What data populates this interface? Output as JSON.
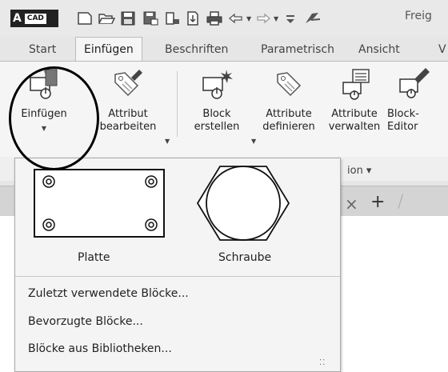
{
  "app": {
    "badge": "A",
    "badge_sub": "CAD",
    "title_partial": "Freig"
  },
  "qat": {
    "icons": [
      "new-file-icon",
      "open-folder-icon",
      "save-icon",
      "save-as-icon",
      "cloud-open-icon",
      "cloud-save-icon",
      "print-icon",
      "undo-icon",
      "redo-icon",
      "customize-dropdown-icon",
      "share-icon"
    ]
  },
  "tabs": [
    {
      "label": "Start",
      "active": false
    },
    {
      "label": "Einfügen",
      "active": true
    },
    {
      "label": "Beschriften",
      "active": false
    },
    {
      "label": "Parametrisch",
      "active": false
    },
    {
      "label": "Ansicht",
      "active": false
    },
    {
      "label": "V",
      "active": false
    }
  ],
  "ribbon": {
    "insert": {
      "line1": "Einfügen",
      "line2": ""
    },
    "edit_attribute": {
      "line1": "Attribut",
      "line2": "bearbeiten"
    },
    "create_block": {
      "line1": "Block",
      "line2": "erstellen"
    },
    "define_attributes": {
      "line1": "Attribute",
      "line2": "definieren"
    },
    "manage_attributes": {
      "line1": "Attribute",
      "line2": "verwalten"
    },
    "block_editor": {
      "line1": "Block-",
      "line2": "Editor"
    },
    "panel_label_partial": "ion ▾"
  },
  "doc_tabs": {
    "close": "×",
    "plus": "+",
    "slash": "/"
  },
  "dropdown": {
    "gallery": [
      {
        "name": "Platte"
      },
      {
        "name": "Schraube"
      }
    ],
    "menu": [
      "Zuletzt verwendete Blöcke...",
      "Bevorzugte Blöcke...",
      "Blöcke aus Bibliotheken..."
    ],
    "grip": "⁚⁚"
  },
  "colors": {
    "ribbon_bg": "#f5f5f5",
    "tab_bar_bg": "#e6e6e6",
    "highlight_circle": "#000000"
  }
}
